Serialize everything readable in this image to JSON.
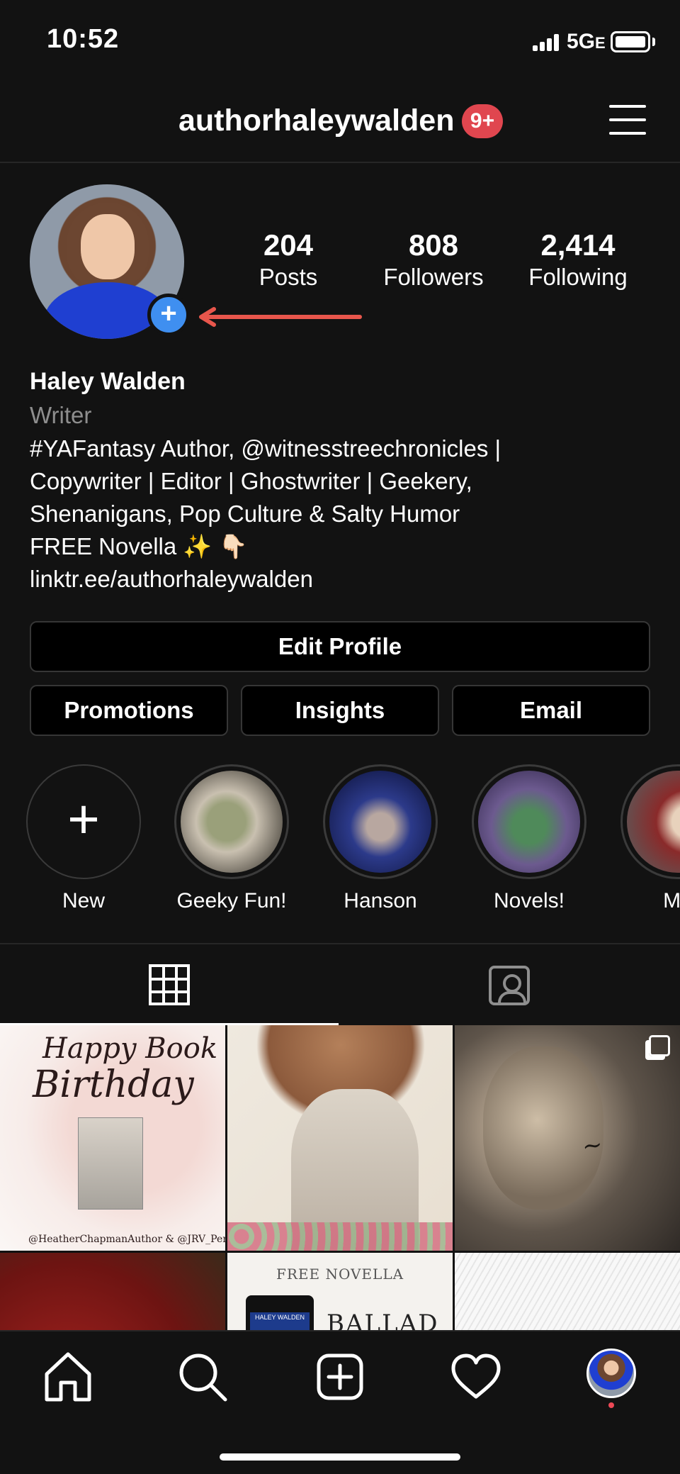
{
  "status_bar": {
    "time": "10:52",
    "network": "5G",
    "network_suffix": "E"
  },
  "header": {
    "username": "authorhaleywalden",
    "notifications_badge": "9+"
  },
  "profile": {
    "add_story_symbol": "+",
    "stats": [
      {
        "value": "204",
        "label": "Posts"
      },
      {
        "value": "808",
        "label": "Followers"
      },
      {
        "value": "2,414",
        "label": "Following"
      }
    ],
    "name": "Haley Walden",
    "category": "Writer",
    "bio_lines": [
      "#YAFantasy Author, @witnesstreechronicles |",
      "Copywriter | Editor | Ghostwriter | Geekery,",
      "Shenanigans, Pop Culture & Salty Humor",
      "FREE Novella ✨ 👇🏻"
    ],
    "link": "linktr.ee/authorhaleywalden"
  },
  "buttons": {
    "edit_profile": "Edit Profile",
    "promotions": "Promotions",
    "insights": "Insights",
    "email": "Email"
  },
  "highlights": [
    {
      "label": "New",
      "is_new": true
    },
    {
      "label": "Geeky Fun!"
    },
    {
      "label": "Hanson"
    },
    {
      "label": "Novels!"
    },
    {
      "label": "Mu"
    }
  ],
  "tabs": [
    {
      "name": "grid",
      "icon": "grid-icon",
      "active": true
    },
    {
      "name": "tagged",
      "icon": "tagged-person-icon",
      "active": false
    }
  ],
  "posts": {
    "p1": {
      "line1": "Happy Book",
      "line2": "Birthday",
      "credit": "@HeatherChapmanAuthor & @JRV_Perry"
    },
    "p5": {
      "header": "FREE NOVELLA",
      "tablet_text": "HALEY WALDEN",
      "title": "BALLAD"
    }
  },
  "bottom_nav": [
    "home-icon",
    "search-icon",
    "create-post-icon",
    "activity-heart-icon",
    "profile-avatar"
  ],
  "colors": {
    "background": "#121212",
    "accent_blue": "#3f8ff0",
    "badge_red": "#e0464f",
    "arrow_red": "#e8564c"
  }
}
